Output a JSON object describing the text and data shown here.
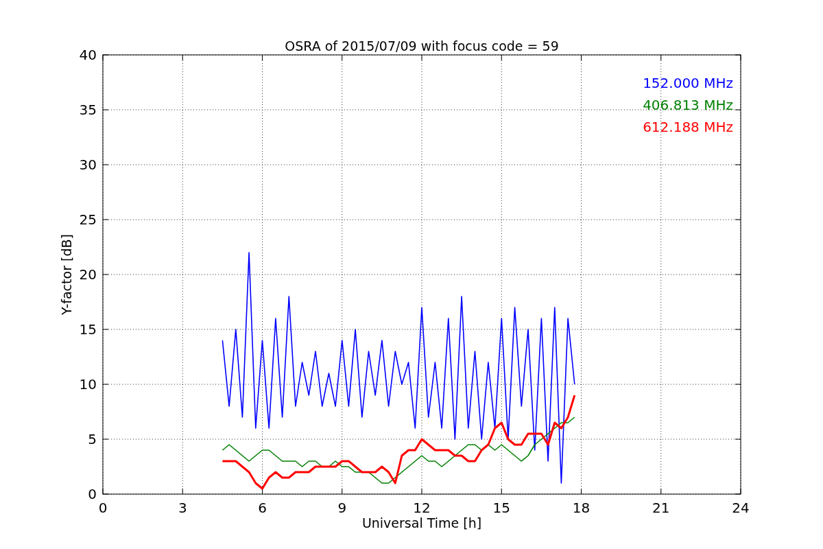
{
  "chart": {
    "chart_data": {
      "type": "line",
      "title": "OSRA of 2015/07/09 with focus code = 59",
      "xlabel": "Universal Time [h]",
      "ylabel": "Y-factor [dB]",
      "x": [
        4.5,
        4.75,
        5,
        5.25,
        5.5,
        5.75,
        6,
        6.25,
        6.5,
        6.75,
        7,
        7.25,
        7.5,
        7.75,
        8,
        8.25,
        8.5,
        8.75,
        9,
        9.25,
        9.5,
        9.75,
        10,
        10.25,
        10.5,
        10.75,
        11,
        11.25,
        11.5,
        11.75,
        12,
        12.25,
        12.5,
        12.75,
        13,
        13.25,
        13.5,
        13.75,
        14,
        14.25,
        14.5,
        14.75,
        15,
        15.25,
        15.5,
        15.75,
        16,
        16.25,
        16.5,
        16.75,
        17,
        17.25,
        17.5,
        17.75
      ],
      "series": [
        {
          "name": "152.000 MHz",
          "color": "#0000ff",
          "values": [
            14,
            8,
            15,
            7,
            22,
            6,
            14,
            6,
            16,
            7,
            18,
            8,
            12,
            9,
            13,
            8,
            11,
            8,
            14,
            8,
            15,
            7,
            13,
            9,
            14,
            8,
            13,
            10,
            12,
            6,
            17,
            7,
            12,
            6,
            16,
            5,
            18,
            6,
            13,
            5,
            12,
            6,
            16,
            5,
            17,
            8,
            15,
            4,
            16,
            3,
            17,
            1,
            16,
            10
          ]
        },
        {
          "name": "406.813 MHz",
          "color": "#008000",
          "values": [
            4,
            4.5,
            4,
            3.5,
            3,
            3.5,
            4,
            4,
            3.5,
            3,
            3,
            3,
            2.5,
            3,
            3,
            2.5,
            2.5,
            3,
            2.5,
            2.5,
            2,
            2,
            2,
            1.5,
            1,
            1,
            1.5,
            2,
            2.5,
            3,
            3.5,
            3,
            3,
            2.5,
            3,
            3.5,
            4,
            4.5,
            4.5,
            4,
            4.5,
            4,
            4.5,
            4,
            3.5,
            3,
            3.5,
            4.5,
            5,
            5.5,
            6,
            6.5,
            6.5,
            7
          ]
        },
        {
          "name": "612.188 MHz",
          "color": "#ff0000",
          "values": [
            3,
            3,
            3,
            2.5,
            2,
            1,
            0.5,
            1.5,
            2,
            1.5,
            1.5,
            2,
            2,
            2,
            2.5,
            2.5,
            2.5,
            2.5,
            3,
            3,
            2.5,
            2,
            2,
            2,
            2.5,
            2,
            1,
            3.5,
            4,
            4,
            5,
            4.5,
            4,
            4,
            4,
            3.5,
            3.5,
            3,
            3,
            4,
            4.5,
            6,
            6.5,
            5,
            4.5,
            4.5,
            5.5,
            5.5,
            5.5,
            4.5,
            6.5,
            6,
            7,
            9
          ]
        }
      ],
      "xlim": [
        0,
        24
      ],
      "ylim": [
        0,
        40
      ],
      "xticks": [
        0,
        3,
        6,
        9,
        12,
        15,
        18,
        21,
        24
      ],
      "yticks": [
        0,
        5,
        10,
        15,
        20,
        25,
        30,
        35,
        40
      ],
      "grid": true
    }
  }
}
